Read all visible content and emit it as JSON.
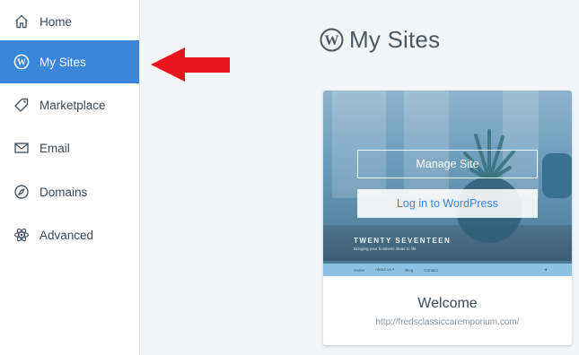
{
  "sidebar": {
    "items": [
      {
        "label": "Home",
        "icon": "home-icon"
      },
      {
        "label": "My Sites",
        "icon": "wordpress-icon",
        "active": true
      },
      {
        "label": "Marketplace",
        "icon": "tag-icon"
      },
      {
        "label": "Email",
        "icon": "envelope-icon"
      },
      {
        "label": "Domains",
        "icon": "compass-icon"
      },
      {
        "label": "Advanced",
        "icon": "atom-icon"
      }
    ]
  },
  "main": {
    "title": "My Sites",
    "site_card": {
      "theme_name": "TWENTY SEVENTEEN",
      "theme_tagline": "Bringing your business ideas to life",
      "theme_menu": [
        "Home",
        "About us ▾",
        "Blog",
        "Contact"
      ],
      "manage_label": "Manage Site",
      "login_label": "Log in to WordPress",
      "site_name": "Welcome",
      "site_url": "http://fredsclassiccaremporium.com/"
    }
  },
  "annotation": {
    "type": "red-arrow",
    "points_to": "sidebar-item-my-sites"
  },
  "colors": {
    "accent": "#3b86d8",
    "arrow": "#e8141b",
    "background": "#f3f6f8"
  }
}
